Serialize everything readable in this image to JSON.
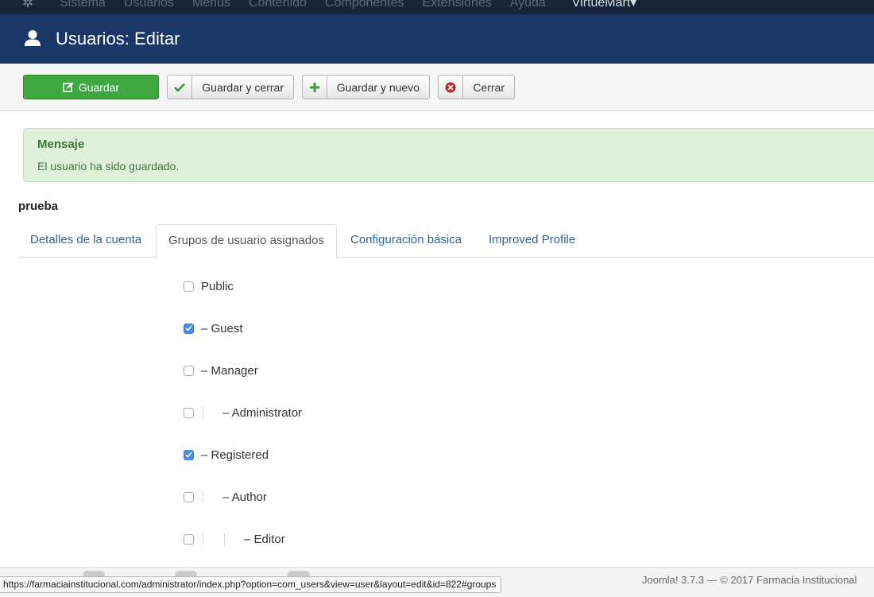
{
  "topnav": {
    "items": [
      "Sistema",
      "Usuarios",
      "Menús",
      "Contenido",
      "Componentes",
      "Extensiones",
      "Ayuda"
    ],
    "virtuemart": "VirtueMart▾"
  },
  "header": {
    "title": "Usuarios: Editar",
    "icon": "user-icon"
  },
  "toolbar": {
    "save_label": "Guardar",
    "save_close_label": "Guardar y cerrar",
    "save_new_label": "Guardar y nuevo",
    "close_label": "Cerrar"
  },
  "message": {
    "heading": "Mensaje",
    "text": "El usuario ha sido guardado."
  },
  "username": "prueba",
  "tabs": [
    {
      "label": "Detalles de la cuenta",
      "active": false
    },
    {
      "label": "Grupos de usuario asignados",
      "active": true
    },
    {
      "label": "Configuración básica",
      "active": false
    },
    {
      "label": "Improved Profile",
      "active": false
    }
  ],
  "groups": [
    {
      "label": "Public",
      "checked": false,
      "level": 0
    },
    {
      "label": "– Guest",
      "checked": true,
      "level": 0
    },
    {
      "label": "– Manager",
      "checked": false,
      "level": 0
    },
    {
      "label": "– Administrator",
      "checked": false,
      "level": 1
    },
    {
      "label": "– Registered",
      "checked": true,
      "level": 0
    },
    {
      "label": "– Author",
      "checked": false,
      "level": 1
    },
    {
      "label": "– Editor",
      "checked": false,
      "level": 2
    }
  ],
  "footer": {
    "copyright": "Joomla! 3.7.3  —  © 2017 Farmacia Institucional"
  },
  "status_url": "https://farmaciainstitucional.com/administrator/index.php?option=com_users&view=user&layout=edit&id=822#groups",
  "colors": {
    "subhead": "#1a3867",
    "save_button": "#3fa73f",
    "alert_bg": "#dff0d8",
    "link": "#2a6496",
    "checkbox_on": "#3f8ef5"
  }
}
